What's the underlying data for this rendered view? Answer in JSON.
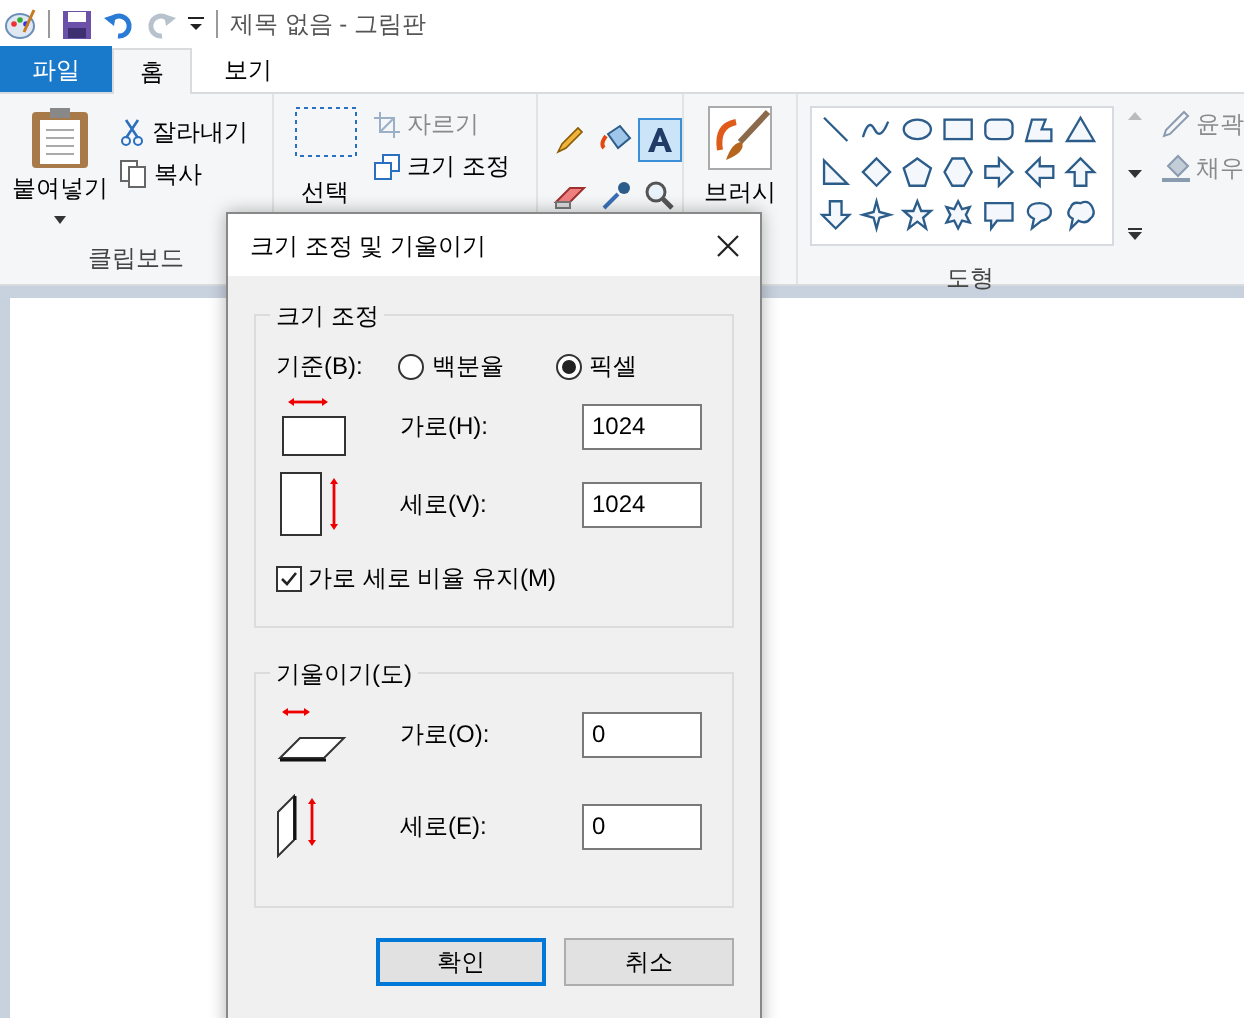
{
  "title_bar": {
    "title": "제목 없음 - 그림판"
  },
  "tabs": [
    {
      "label": "파일",
      "kind": "file",
      "selected": false
    },
    {
      "label": "홈",
      "kind": "tab",
      "selected": true
    },
    {
      "label": "보기",
      "kind": "tab",
      "selected": false
    }
  ],
  "clipboard": {
    "paste": "붙여넣기",
    "cut": "잘라내기",
    "copy": "복사",
    "label": "클립보드"
  },
  "image": {
    "select": "선택",
    "crop": "자르기",
    "crop_disabled": true,
    "resize": "크기 조정"
  },
  "tools": [
    {
      "kind": "pencil",
      "selected": false
    },
    {
      "kind": "fill",
      "selected": false
    },
    {
      "kind": "text",
      "selected": true
    },
    {
      "kind": "eraser",
      "selected": false
    },
    {
      "kind": "picker",
      "selected": false
    },
    {
      "kind": "magnifier",
      "selected": false
    }
  ],
  "brushes": {
    "label": "브러시"
  },
  "shapes": {
    "label": "도형",
    "outline": "윤곽",
    "fill": "채우",
    "options_disabled": true
  },
  "dialog": {
    "title": "크기 조정 및 기울이기",
    "resize": {
      "legend": "크기 조정",
      "basis_label": "기준(B):",
      "options": [
        {
          "label": "백분율",
          "selected": false
        },
        {
          "label": "픽셀",
          "selected": true
        }
      ],
      "fields": [
        {
          "label": "가로(H):",
          "value": "1024",
          "kind": "horizontal"
        },
        {
          "label": "세로(V):",
          "value": "1024",
          "kind": "vertical"
        }
      ],
      "keep_ratio": {
        "label": "가로 세로 비율 유지(M)",
        "checked": true
      }
    },
    "skew": {
      "legend": "기울이기(도)",
      "fields": [
        {
          "label": "가로(O):",
          "value": "0",
          "kind": "horizontal"
        },
        {
          "label": "세로(E):",
          "value": "0",
          "kind": "vertical"
        }
      ]
    },
    "buttons": [
      {
        "label": "확인",
        "kind": "default"
      },
      {
        "label": "취소",
        "kind": "normal"
      }
    ]
  }
}
